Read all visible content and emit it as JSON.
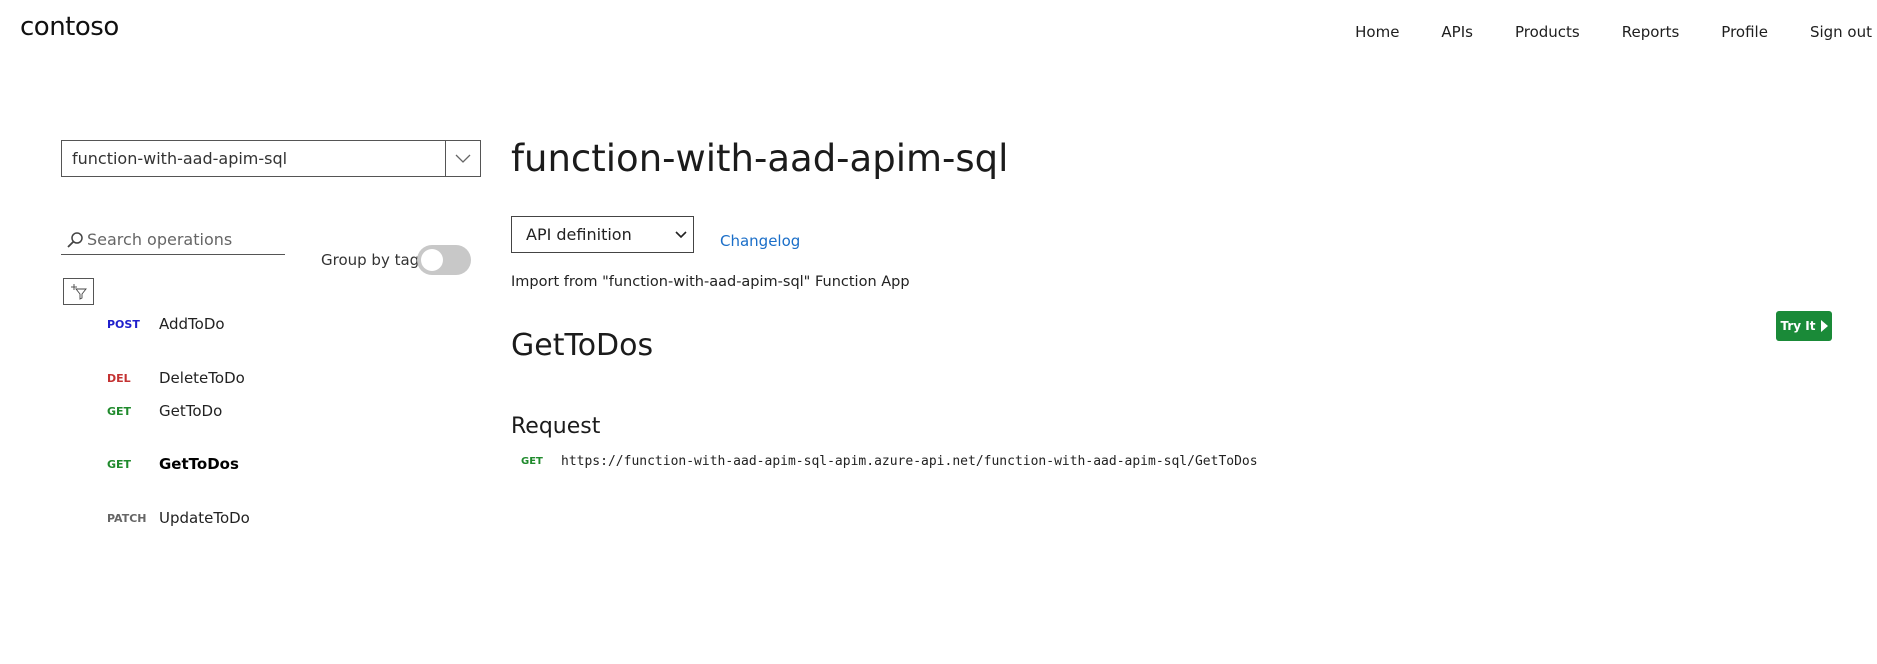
{
  "header": {
    "logo": "contoso",
    "nav": [
      "Home",
      "APIs",
      "Products",
      "Reports",
      "Profile",
      "Sign out"
    ]
  },
  "sidebar": {
    "api_selected": "function-with-aad-apim-sql",
    "search_placeholder": "Search operations",
    "group_by_tag_label": "Group by tag",
    "group_by_tag_on": false,
    "operations": [
      {
        "method": "POST",
        "name": "AddToDo",
        "color": "#1f1fcc"
      },
      {
        "method": "DEL",
        "name": "DeleteToDo",
        "color": "#c43232"
      },
      {
        "method": "GET",
        "name": "GetToDo",
        "color": "#1f8a2c"
      },
      {
        "method": "GET",
        "name": "GetToDos",
        "color": "#1f8a2c",
        "active": true
      },
      {
        "method": "PATCH",
        "name": "UpdateToDo",
        "color": "#666666"
      }
    ]
  },
  "main": {
    "title": "function-with-aad-apim-sql",
    "definition_select": "API definition",
    "changelog": "Changelog",
    "description": "Import from \"function-with-aad-apim-sql\" Function App",
    "operation_title": "GetToDos",
    "try_it": "Try It",
    "request_heading": "Request",
    "request_method": "GET",
    "request_url": "https://function-with-aad-apim-sql-apim.azure-api.net/function-with-aad-apim-sql/GetToDos"
  },
  "colors": {
    "try_it_bg": "#1a8a38",
    "link": "#1a6ec8",
    "get": "#1f8a2c"
  }
}
